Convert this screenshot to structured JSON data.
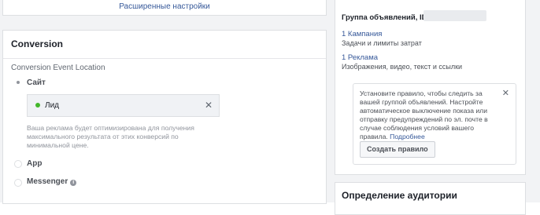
{
  "top_card": {
    "advanced_settings_link": "Расширенные настройки"
  },
  "conversion": {
    "title": "Conversion",
    "event_location_label": "Conversion Event Location",
    "options": [
      {
        "label": "Сайт",
        "selected": true
      },
      {
        "label": "App",
        "selected": false
      },
      {
        "label": "Messenger",
        "selected": false
      }
    ],
    "event": {
      "label": "Лид",
      "status_color": "#42b72a"
    },
    "help_text": "Ваша реклама будет оптимизирована для получения максимального результата от этих конверсий по минимальной цене."
  },
  "summary": {
    "adset_title": "Группа объявлений, ID:",
    "campaign_link": "1 Кампания",
    "campaign_desc": "Задачи и лимиты затрат",
    "ads_link": "1 Реклама",
    "ads_desc": "Изображения, видео, текст и ссылки",
    "tip": {
      "text": "Установите правило, чтобы следить за вашей группой объявлений. Настройте автоматическое выключение показа или отправку предупреждений по эл. почте в случае соблюдения условий вашего правила.",
      "more_link": "Подробнее",
      "button": "Создать правило"
    }
  },
  "audience": {
    "title": "Определение аудитории"
  }
}
